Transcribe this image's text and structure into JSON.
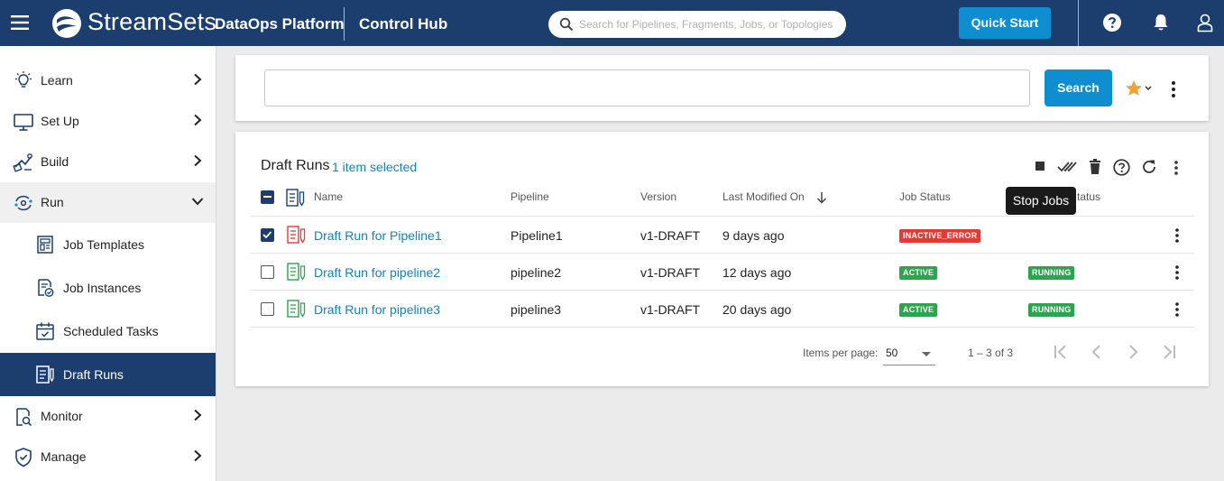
{
  "topbar": {
    "brand": "StreamSets",
    "platform": "DataOps Platform",
    "hub": "Control Hub",
    "search_placeholder": "Search for Pipelines, Fragments, Jobs, or Topologies",
    "quick_start": "Quick Start",
    "icons": [
      "hamburger-icon",
      "streamsets-logo",
      "search-icon",
      "help-icon",
      "bell-icon",
      "user-icon"
    ]
  },
  "sidebar": {
    "items": [
      {
        "label": "Learn",
        "icon": "lightbulb-icon",
        "chevron": "right"
      },
      {
        "label": "Set Up",
        "icon": "monitor-icon",
        "chevron": "right"
      },
      {
        "label": "Build",
        "icon": "build-icon",
        "chevron": "right"
      },
      {
        "label": "Run",
        "icon": "run-icon",
        "chevron": "down"
      },
      {
        "label": "Monitor",
        "icon": "monitor-search-icon",
        "chevron": "right"
      },
      {
        "label": "Manage",
        "icon": "shield-icon",
        "chevron": "right"
      }
    ],
    "run_subitems": [
      {
        "label": "Job Templates",
        "icon": "job-template-icon"
      },
      {
        "label": "Job Instances",
        "icon": "job-instance-icon"
      },
      {
        "label": "Scheduled Tasks",
        "icon": "calendar-icon"
      },
      {
        "label": "Draft Runs",
        "icon": "draft-run-icon",
        "active": true
      }
    ]
  },
  "search_panel": {
    "query": "",
    "search_label": "Search"
  },
  "table": {
    "title": "Draft Runs",
    "selected_text": "1 item selected",
    "headers": {
      "name": "Name",
      "pipeline": "Pipeline",
      "version": "Version",
      "last_modified": "Last Modified On",
      "job_status": "Job Status",
      "status_partial": "tatus"
    },
    "rows": [
      {
        "name": "Draft Run for Pipeline1",
        "pipeline": "Pipeline1",
        "version": "v1-DRAFT",
        "modified": "9 days ago",
        "job_status": "INACTIVE_ERROR",
        "status": "",
        "checked": true
      },
      {
        "name": "Draft Run for pipeline2",
        "pipeline": "pipeline2",
        "version": "v1-DRAFT",
        "modified": "12 days ago",
        "job_status": "ACTIVE",
        "status": "RUNNING",
        "checked": false
      },
      {
        "name": "Draft Run for pipeline3",
        "pipeline": "pipeline3",
        "version": "v1-DRAFT",
        "modified": "20 days ago",
        "job_status": "ACTIVE",
        "status": "RUNNING",
        "checked": false
      }
    ],
    "tooltip": "Stop Jobs",
    "toolbar_icons": [
      "stop-icon",
      "acknowledge-icon",
      "delete-icon",
      "help-icon",
      "refresh-icon",
      "more-icon"
    ]
  },
  "pager": {
    "items_per_page_label": "Items per page:",
    "items_per_page": "50",
    "range": "1 – 3 of 3"
  },
  "colors": {
    "header": "#1b3e6f",
    "accent": "#0e8ed0",
    "link": "#1382c1",
    "error": "#e53935",
    "success": "#2ea44f"
  }
}
